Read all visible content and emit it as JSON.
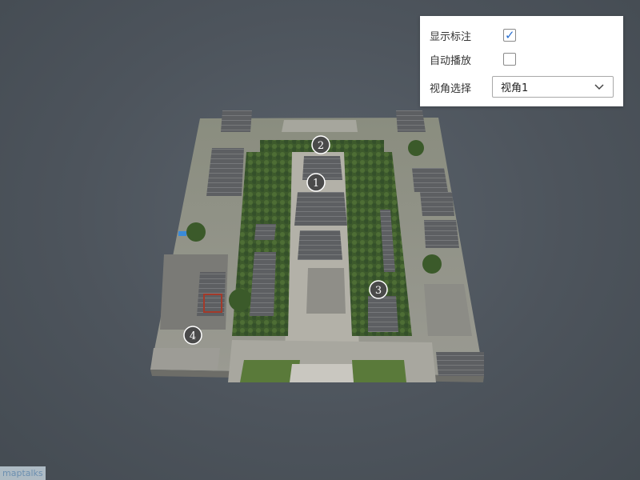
{
  "panel": {
    "show_labels": {
      "label": "显示标注",
      "checked": true
    },
    "autoplay": {
      "label": "自动播放",
      "checked": false
    },
    "view_select": {
      "label": "视角选择",
      "value": "视角1"
    }
  },
  "markers": [
    "1",
    "2",
    "3",
    "4"
  ],
  "logo": "maptalks",
  "colors": {
    "accent": "#2a6fd0",
    "background": "#4d545c"
  }
}
